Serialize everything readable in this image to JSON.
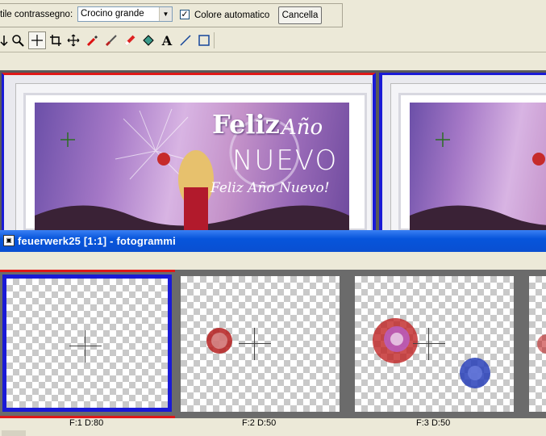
{
  "options": {
    "style_label": "tile contrassegno:",
    "style_value": "Crocino grande",
    "auto_color_label": "Colore automatico",
    "auto_color_checked": true,
    "cancel_label": "Cancella"
  },
  "toolbar": {
    "tools": [
      "arrow-icon",
      "zoom-icon",
      "crosshair-icon",
      "crop-icon",
      "move-icon",
      "dropper-icon",
      "brush-icon",
      "eraser-icon",
      "fill-icon",
      "text-icon",
      "line-icon",
      "rectangle-icon"
    ],
    "active_tool": "crosshair-icon"
  },
  "image_window": {
    "banner_title": "Feliz",
    "banner_title2": "Año",
    "banner_subtitle": "NUEVO",
    "banner_script": "Feliz Año Nuevo!"
  },
  "frames_window": {
    "title": "feuerwerk25 [1:1] - fotogrammi",
    "frames": [
      {
        "label": "F:1   D:80",
        "selected": true
      },
      {
        "label": "F:2   D:50",
        "selected": false
      },
      {
        "label": "F:3   D:50",
        "selected": false
      }
    ]
  },
  "colors": {
    "selection_blue": "#1a1ad6",
    "selection_red": "#e01818",
    "titlebar": "#0a4fd1"
  }
}
